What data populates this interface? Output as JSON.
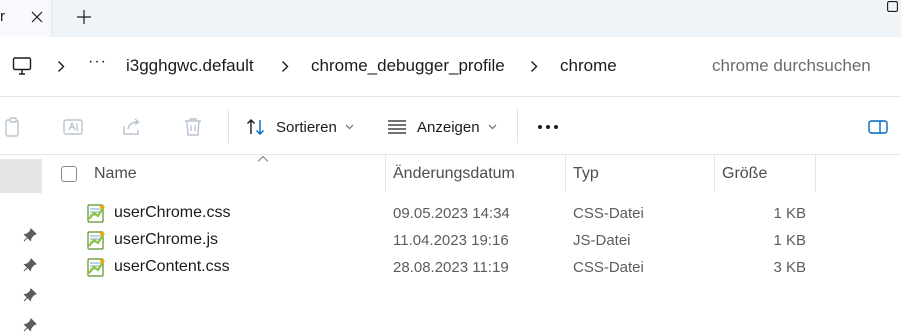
{
  "tabbar": {
    "tab_partial_text": "r",
    "new_tab_glyph": "+"
  },
  "breadcrumb": {
    "overflow": "···",
    "items": [
      "i3gghgwc.default",
      "chrome_debugger_profile",
      "chrome"
    ]
  },
  "search": {
    "placeholder": "chrome durchsuchen"
  },
  "toolbar": {
    "sort_label": "Sortieren",
    "view_label": "Anzeigen",
    "more_glyph": "•••"
  },
  "columns": {
    "name": "Name",
    "date": "Änderungsdatum",
    "type": "Typ",
    "size": "Größe"
  },
  "files": [
    {
      "name": "userChrome.css",
      "date": "09.05.2023 14:34",
      "type": "CSS-Datei",
      "size": "1 KB",
      "icon": "notepadpp-file-icon"
    },
    {
      "name": "userChrome.js",
      "date": "11.04.2023 19:16",
      "type": "JS-Datei",
      "size": "1 KB",
      "icon": "notepadpp-file-icon"
    },
    {
      "name": "userContent.css",
      "date": "28.08.2023 11:19",
      "type": "CSS-Datei",
      "size": "3 KB",
      "icon": "notepadpp-file-icon"
    }
  ],
  "colors": {
    "accent": "#0067c0",
    "tabbar_bg": "#eff4f9",
    "nav_selected": "#e6e6e6"
  }
}
